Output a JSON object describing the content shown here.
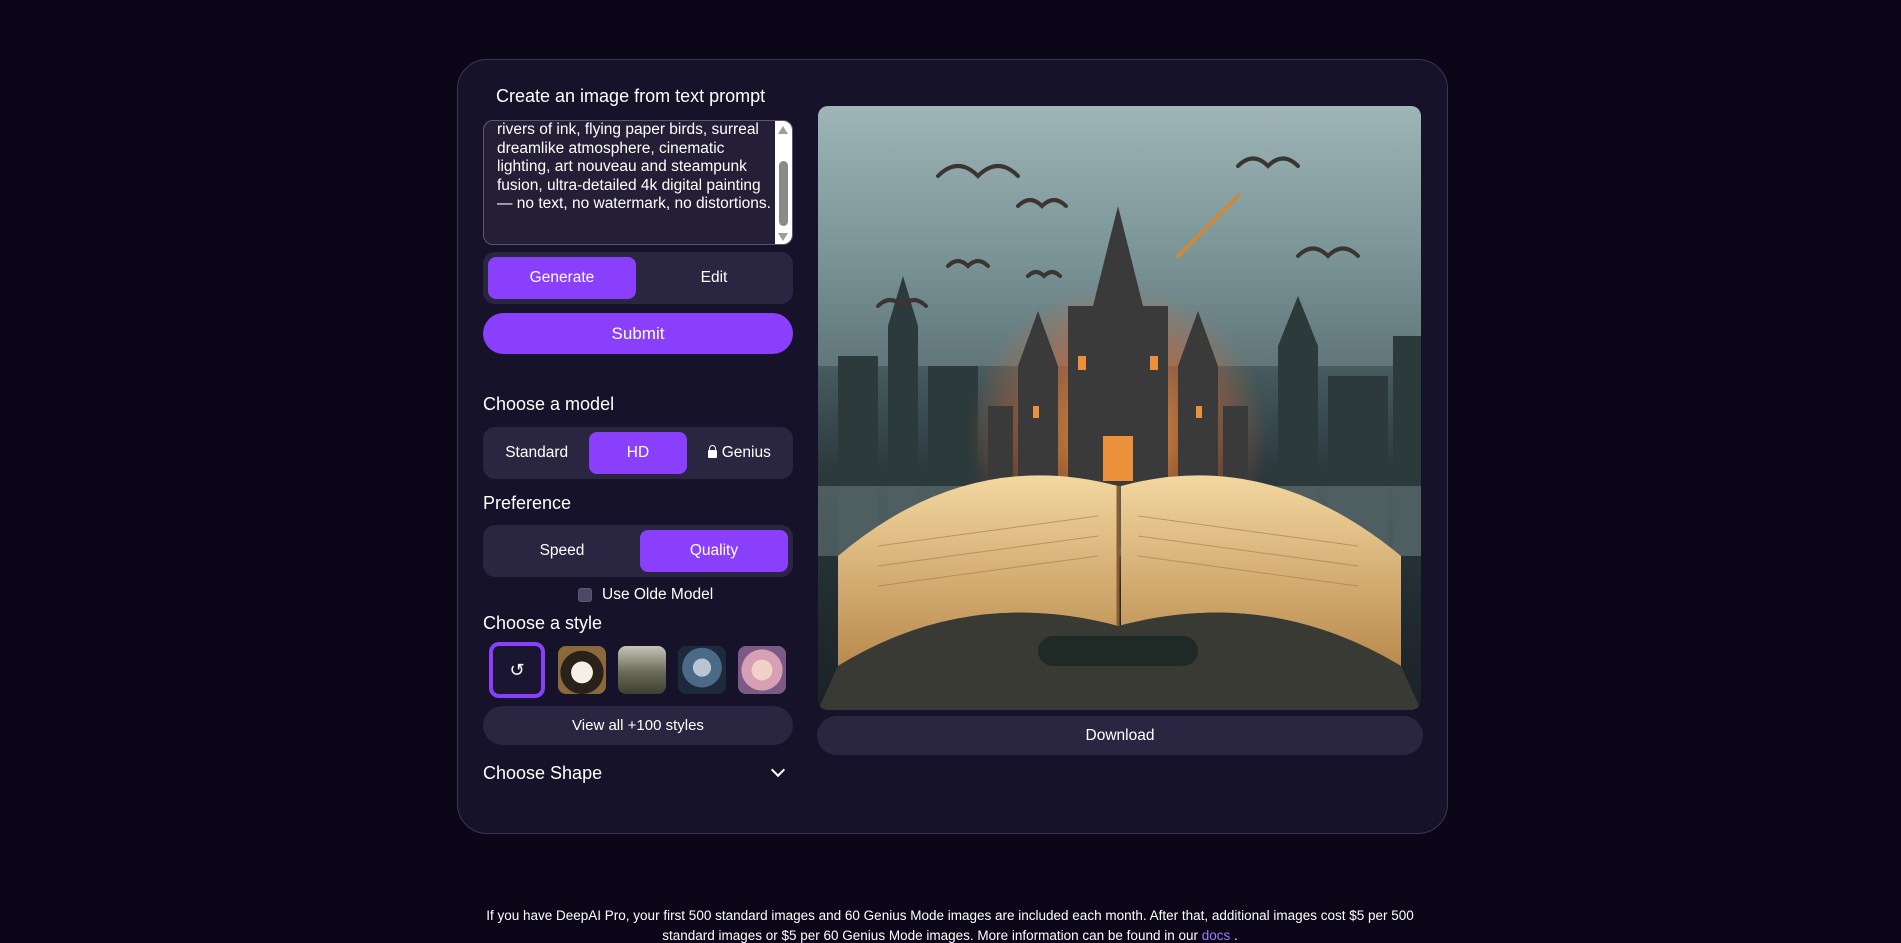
{
  "top_fade_text": "",
  "panel": {
    "title": "Create an image from text prompt",
    "prompt_text": "rivers of ink, flying paper birds, surreal dreamlike atmosphere, cinematic lighting, art nouveau and steampunk fusion, ultra-detailed 4k digital painting — no text, no watermark, no distortions.",
    "mode_tabs": [
      {
        "label": "Generate",
        "active": true
      },
      {
        "label": "Edit",
        "active": false
      }
    ],
    "submit_label": "Submit",
    "model": {
      "label": "Choose a model",
      "options": [
        {
          "label": "Standard",
          "active": false,
          "locked": false
        },
        {
          "label": "HD",
          "active": true,
          "locked": false
        },
        {
          "label": "Genius",
          "active": false,
          "locked": true
        }
      ]
    },
    "preference": {
      "label": "Preference",
      "options": [
        {
          "label": "Speed",
          "active": false
        },
        {
          "label": "Quality",
          "active": true
        }
      ]
    },
    "olde_model": {
      "label": "Use Olde Model",
      "checked": false
    },
    "style": {
      "label": "Choose a style",
      "thumbnails": [
        "no-style-icon",
        "panda",
        "forest",
        "astronaut",
        "anime-girl"
      ],
      "selected": "no-style-icon",
      "view_all_label": "View all +100 styles"
    },
    "shape": {
      "label": "Choose Shape"
    },
    "download_label": "Download"
  },
  "colors": {
    "accent": "#8a3ffc",
    "background": "#0b0719",
    "panel": "#16122a",
    "control": "#2a2540",
    "link": "#a07cff"
  },
  "footer": {
    "text_before": "If you have DeepAI Pro, your first 500 standard images and 60 Genius Mode images are included each month. After that, additional images cost $5 per 500 standard images or $5 per 60 Genius Mode images. More information can be found in our ",
    "link_text": "docs",
    "text_after": " ."
  }
}
